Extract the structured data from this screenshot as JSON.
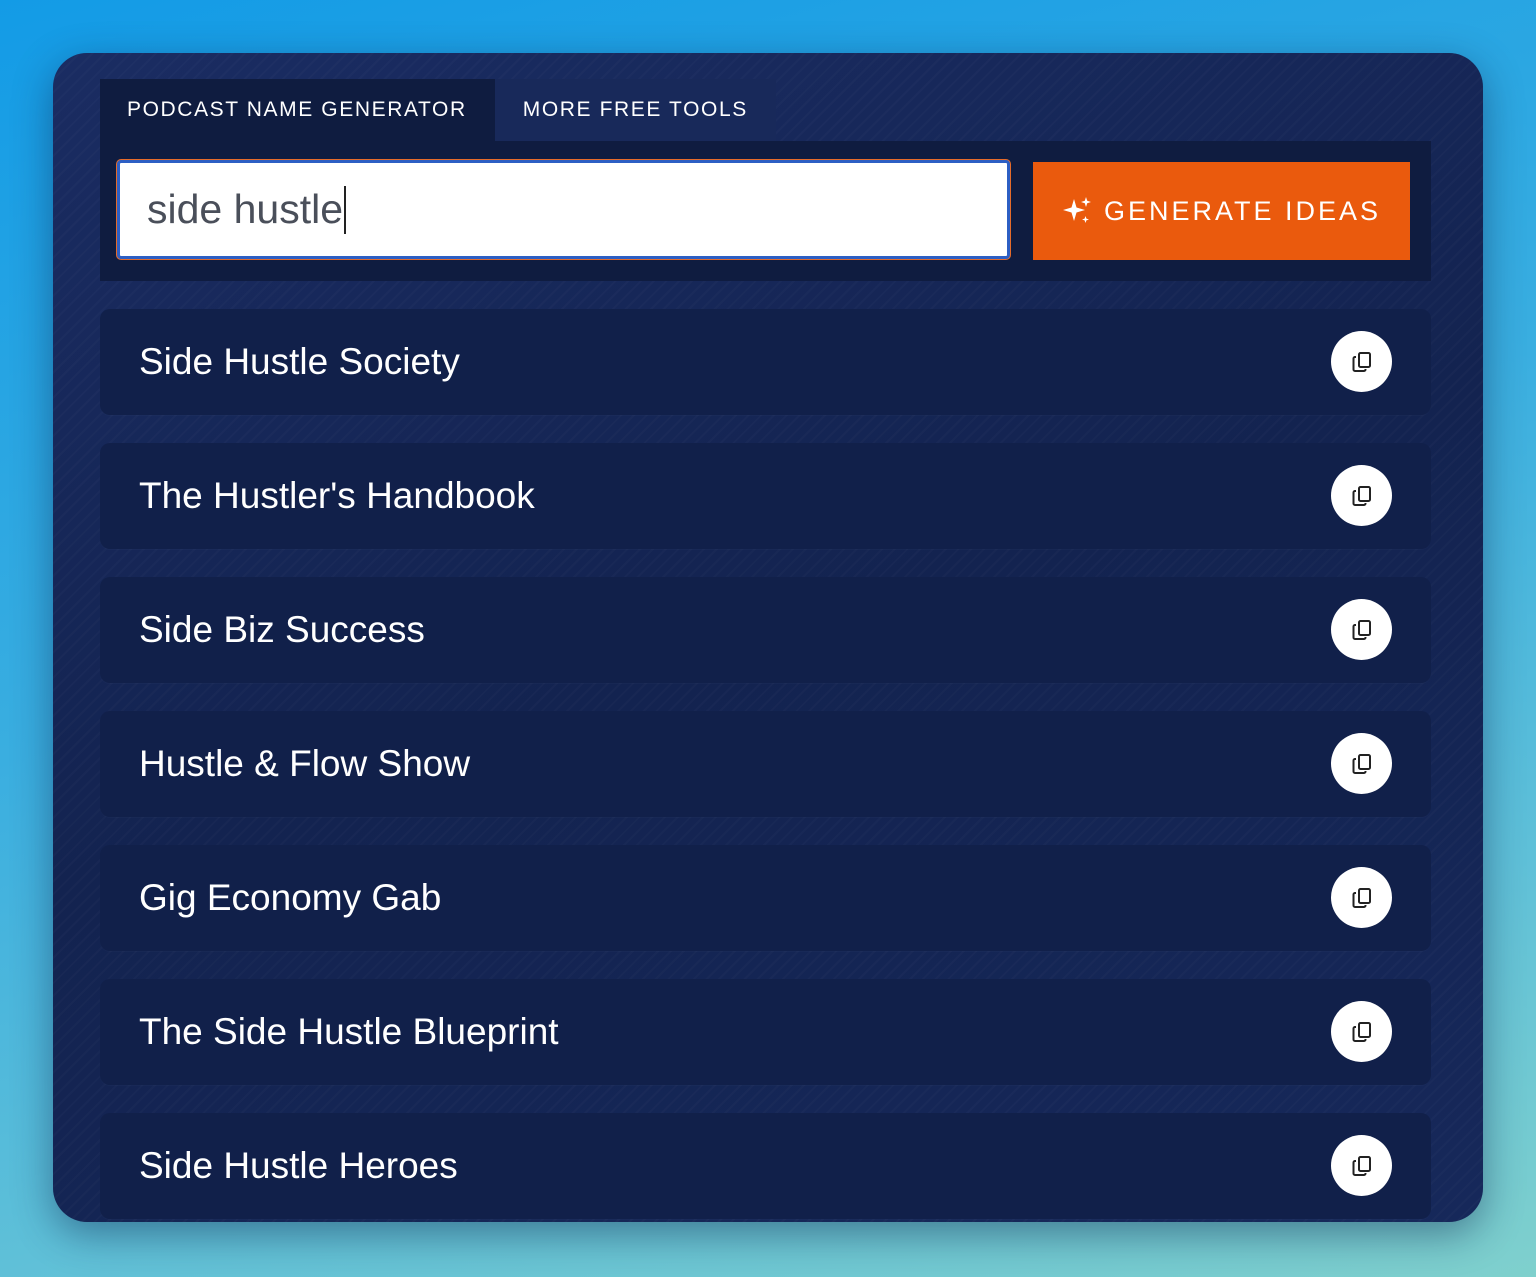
{
  "tabs": [
    {
      "label": "PODCAST NAME GENERATOR",
      "active": true
    },
    {
      "label": "MORE FREE TOOLS",
      "active": false
    }
  ],
  "search": {
    "value": "side hustle"
  },
  "generate_button": {
    "label": "GENERATE IDEAS",
    "icon": "sparkle-icon"
  },
  "results": [
    {
      "name": "Side Hustle Society"
    },
    {
      "name": "The Hustler's Handbook"
    },
    {
      "name": "Side Biz Success"
    },
    {
      "name": "Hustle & Flow Show"
    },
    {
      "name": "Gig Economy Gab"
    },
    {
      "name": "The Side Hustle Blueprint"
    },
    {
      "name": "Side Hustle Heroes"
    }
  ],
  "copy_icon": "copy-icon",
  "colors": {
    "card_bg": "#142454",
    "accent": "#ea5a0d",
    "row_bg": "#11204a",
    "page_gradient_top": "#139be6",
    "page_gradient_bottom": "#7fd0cd"
  }
}
